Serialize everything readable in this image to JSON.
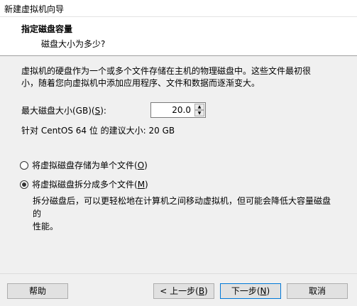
{
  "window": {
    "title": "新建虚拟机向导"
  },
  "header": {
    "title": "指定磁盘容量",
    "subtitle": "磁盘大小为多少?"
  },
  "description": {
    "line1": "虚拟机的硬盘作为一个或多个文件存储在主机的物理磁盘中。这些文件最初很",
    "line2": "小，随着您向虚拟机中添加应用程序、文件和数据而逐渐变大。"
  },
  "disk_size": {
    "label": "最大磁盘大小(GB)(",
    "accel": "S",
    "label_end": "):",
    "value": "20.0"
  },
  "recommended": "针对 CentOS 64 位 的建议大小: 20 GB",
  "options": [
    {
      "label": "将虚拟磁盘存储为单个文件(",
      "accel": "O",
      "end": ")",
      "selected": false
    },
    {
      "label": "将虚拟磁盘拆分成多个文件(",
      "accel": "M",
      "end": ")",
      "selected": true
    }
  ],
  "split_description": {
    "line1": "拆分磁盘后，可以更轻松地在计算机之间移动虚拟机，但可能会降低大容量磁盘的",
    "line2": "性能。"
  },
  "buttons": {
    "help": "帮助",
    "back": "< 上一步(",
    "back_accel": "B",
    "back_end": ")",
    "next": "下一步(",
    "next_accel": "N",
    "next_end": ")",
    "cancel": "取消"
  }
}
